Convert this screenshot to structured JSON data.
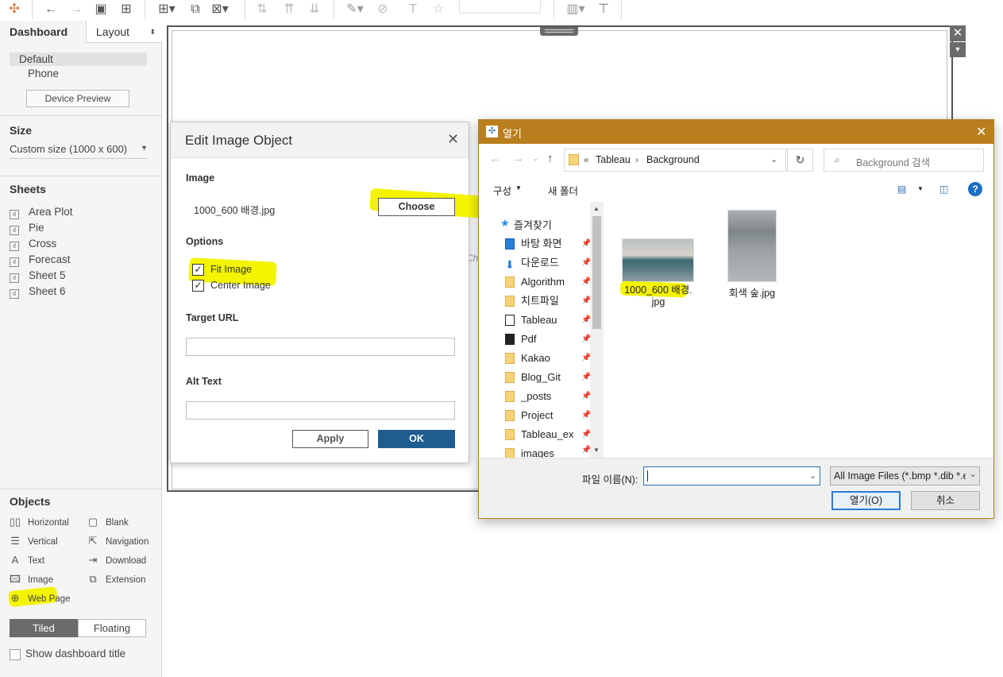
{
  "left_pane": {
    "tabs": [
      "Dashboard",
      "Layout"
    ],
    "devices": [
      "Default",
      "Phone"
    ],
    "device_preview": "Device Preview",
    "size_title": "Size",
    "size_value": "Custom size (1000 x 600)",
    "sheets_title": "Sheets",
    "sheets": [
      "Area Plot",
      "Pie",
      "Cross",
      "Forecast",
      "Sheet 5",
      "Sheet 6"
    ],
    "objects_title": "Objects",
    "objects_left": [
      "Horizontal",
      "Vertical",
      "Text",
      "Image",
      "Web Page"
    ],
    "objects_right": [
      "Blank",
      "Navigation",
      "Download",
      "Extension"
    ],
    "tiled": "Tiled",
    "floating": "Floating",
    "show_title": "Show dashboard title"
  },
  "canvas": {
    "partial_text": "Ch"
  },
  "edit_dialog": {
    "title": "Edit Image Object",
    "image_label": "Image",
    "file_name": "1000_600 배경.jpg",
    "choose": "Choose",
    "options_label": "Options",
    "fit_image": "Fit Image",
    "center_image": "Center Image",
    "target_url": "Target URL",
    "alt_text": "Alt Text",
    "apply": "Apply",
    "ok": "OK",
    "close": "✕"
  },
  "open_dialog": {
    "title": "열기",
    "breadcrumb": [
      "Tableau",
      "Background"
    ],
    "search_placeholder": "Background 검색",
    "organize": "구성",
    "new_folder": "새 폴더",
    "quick_access": "즐겨찾기",
    "nav_items": [
      "바탕 화면",
      "다운로드",
      "Algorithm",
      "치트파일",
      "Tableau",
      "Pdf",
      "Kakao",
      "Blog_Git",
      "_posts",
      "Project",
      "Tableau_ex",
      "images"
    ],
    "files": [
      {
        "name_line1": "1000_600 배경.",
        "name_line2": "jpg"
      },
      {
        "name_line1": "회색 숲.jpg",
        "name_line2": ""
      }
    ],
    "filename_label": "파일 이름(N):",
    "filter": "All Image Files (*.bmp *.dib *.e",
    "open_btn": "열기(O)",
    "cancel_btn": "취소"
  },
  "colors": {
    "accent": "#1f5d91",
    "titlebar": "#b97e1e",
    "highlight": "#f4f400"
  }
}
